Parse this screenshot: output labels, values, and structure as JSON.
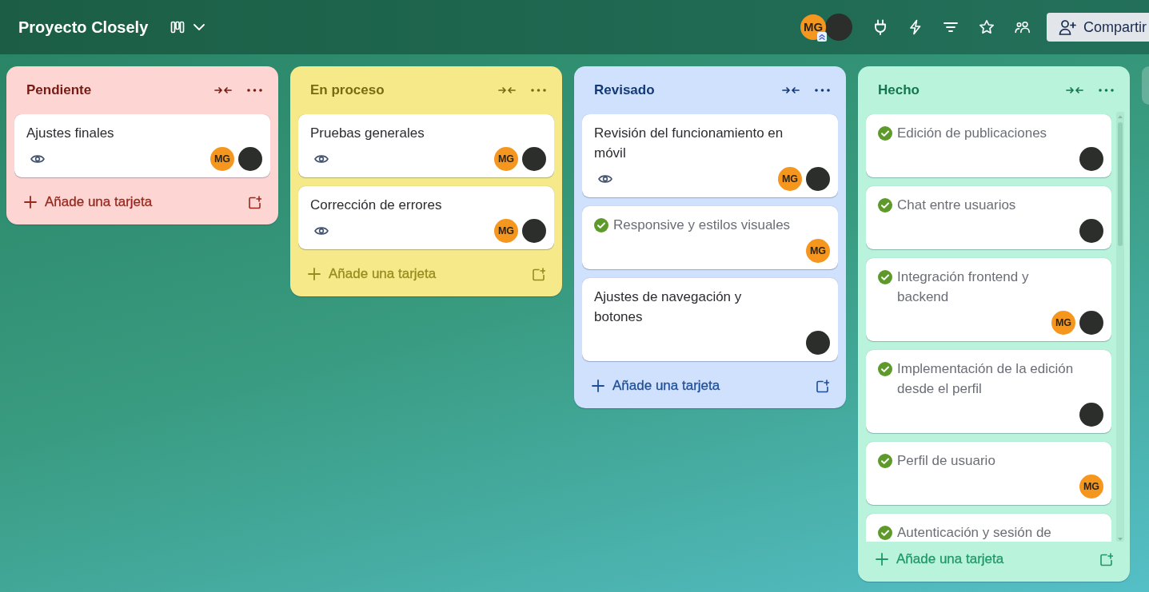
{
  "header": {
    "title": "Proyecto Closely",
    "members": [
      {
        "kind": "initials",
        "initials": "MG",
        "admin": true
      },
      {
        "kind": "photo"
      }
    ],
    "share_button": "Compartir"
  },
  "lists": [
    {
      "title": "Pendiente",
      "color": "#fdd5d2",
      "cards": [
        {
          "title": "Ajustes finales",
          "done": false,
          "watching": true,
          "members": [
            {
              "kind": "initials",
              "initials": "MG"
            },
            {
              "kind": "photo"
            }
          ]
        }
      ],
      "add_card": "Añade una tarjeta"
    },
    {
      "title": "En proceso",
      "color": "#f5e989",
      "cards": [
        {
          "title": "Pruebas generales",
          "done": false,
          "watching": true,
          "members": [
            {
              "kind": "initials",
              "initials": "MG"
            },
            {
              "kind": "photo"
            }
          ]
        },
        {
          "title": "Corrección de errores",
          "done": false,
          "watching": true,
          "members": [
            {
              "kind": "initials",
              "initials": "MG"
            },
            {
              "kind": "photo"
            }
          ]
        }
      ],
      "add_card": "Añade una tarjeta"
    },
    {
      "title": "Revisado",
      "color": "#cfe1fd",
      "cards": [
        {
          "title": "Revisión del funcionamiento en móvil",
          "done": false,
          "watching": true,
          "members": [
            {
              "kind": "initials",
              "initials": "MG"
            },
            {
              "kind": "photo"
            }
          ]
        },
        {
          "title": "Responsive y estilos visuales",
          "done": true,
          "watching": false,
          "members": [
            {
              "kind": "initials",
              "initials": "MG"
            }
          ]
        },
        {
          "title": "Ajustes de navegación y botones",
          "done": false,
          "watching": false,
          "members": [
            {
              "kind": "photo"
            }
          ]
        }
      ],
      "add_card": "Añade una tarjeta"
    },
    {
      "title": "Hecho",
      "color": "#baf3db",
      "cards": [
        {
          "title": "Edición de publicaciones",
          "done": true,
          "watching": false,
          "members": [
            {
              "kind": "photo"
            }
          ]
        },
        {
          "title": "Chat entre usuarios",
          "done": true,
          "watching": false,
          "members": [
            {
              "kind": "photo"
            }
          ]
        },
        {
          "title": "Integración frontend y backend",
          "done": true,
          "watching": false,
          "members": [
            {
              "kind": "initials",
              "initials": "MG"
            },
            {
              "kind": "photo"
            }
          ]
        },
        {
          "title": "Implementación de la edición desde el perfil",
          "done": true,
          "watching": false,
          "members": [
            {
              "kind": "photo"
            }
          ]
        },
        {
          "title": "Perfil de usuario",
          "done": true,
          "watching": false,
          "members": [
            {
              "kind": "initials",
              "initials": "MG"
            }
          ]
        },
        {
          "title": "Autenticación y sesión de",
          "done": true,
          "watching": false
        }
      ],
      "add_card": "Añade una tarjeta"
    }
  ]
}
